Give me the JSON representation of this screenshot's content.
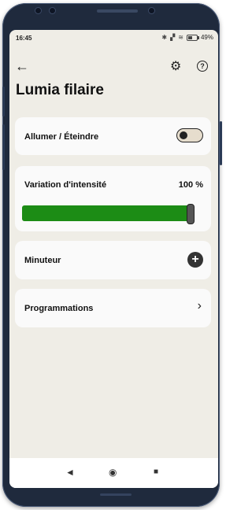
{
  "status_bar": {
    "time": "16:45",
    "bluetooth_icon": "bluetooth-icon",
    "battery_text": "49%",
    "battery_level": 0.49
  },
  "toolbar": {
    "back_icon": "←",
    "settings_icon": "⚙",
    "help_icon": "?"
  },
  "page": {
    "title": "Lumia filaire"
  },
  "cards": {
    "power": {
      "label": "Allumer / Éteindre",
      "on": false
    },
    "dimmer": {
      "label": "Variation d'intensité",
      "value_text": "100 %",
      "value": 1.0
    },
    "timer": {
      "label": "Minuteur",
      "add_icon": "+"
    },
    "schedules": {
      "label": "Programmations",
      "chevron": "›"
    }
  },
  "navbar": {
    "back": "◄",
    "home": "◉",
    "recents": "■"
  },
  "colors": {
    "accent": "#1c8c15",
    "background": "#efede6",
    "card": "#fafafa",
    "phone_frame": "#1f2a3d"
  }
}
